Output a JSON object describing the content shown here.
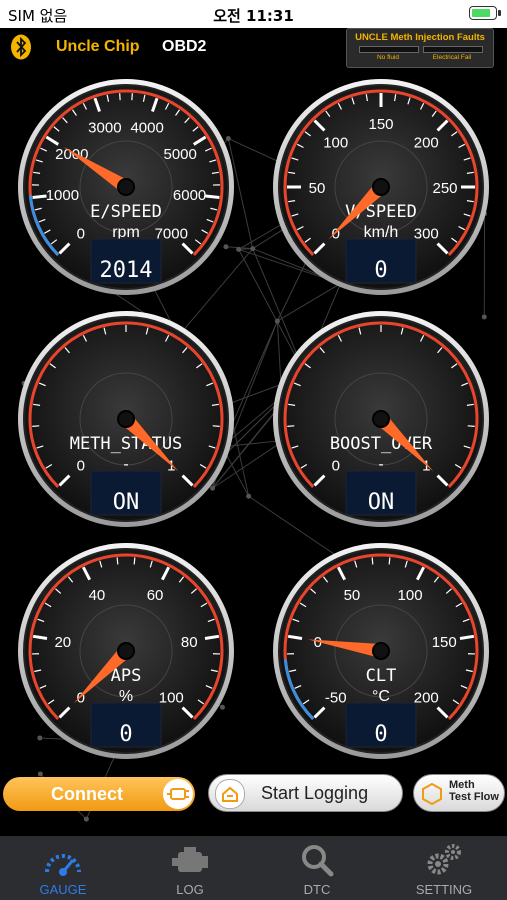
{
  "status_bar": {
    "carrier": "SIM 없음",
    "time": "오전 11:31"
  },
  "header": {
    "brand": "Uncle Chip",
    "protocol": "OBD2"
  },
  "fault_panel": {
    "title": "UNCLE Meth Injection Faults",
    "indicators": [
      "No fluid",
      "Electrical Fail"
    ]
  },
  "gauges": [
    {
      "label": "E/SPEED",
      "unit": "rpm",
      "display": "2014",
      "ticks": [
        "0",
        "1000",
        "2000",
        "3000",
        "4000",
        "5000",
        "6000",
        "7000"
      ],
      "min": 0,
      "max": 7000,
      "value": 2014
    },
    {
      "label": "V/SPEED",
      "unit": "km/h",
      "display": "0",
      "ticks": [
        "0",
        "50",
        "100",
        "150",
        "200",
        "250",
        "300"
      ],
      "min": 0,
      "max": 300,
      "value": 0
    },
    {
      "label": "METH_STATUS",
      "unit": "-",
      "display": "ON",
      "ticks": [
        "0",
        "1"
      ],
      "min": 0,
      "max": 1,
      "value": 1
    },
    {
      "label": "BOOST_OVER",
      "unit": "-",
      "display": "ON",
      "ticks": [
        "0",
        "1"
      ],
      "min": 0,
      "max": 1,
      "value": 1
    },
    {
      "label": "APS",
      "unit": "%",
      "display": "0",
      "ticks": [
        "0",
        "20",
        "40",
        "60",
        "80",
        "100"
      ],
      "min": 0,
      "max": 100,
      "value": 0
    },
    {
      "label": "CLT",
      "unit": "°C",
      "display": "0",
      "ticks": [
        "-50",
        "0",
        "50",
        "100",
        "150",
        "200"
      ],
      "min": -50,
      "max": 200,
      "value": 0
    }
  ],
  "buttons": {
    "connect": "Connect",
    "start_logging": "Start Logging",
    "meth_test_line1": "Meth",
    "meth_test_line2": "Test Flow"
  },
  "tabs": [
    {
      "label": "GAUGE",
      "icon": "gauge-icon",
      "active": true
    },
    {
      "label": "LOG",
      "icon": "engine-icon",
      "active": false
    },
    {
      "label": "DTC",
      "icon": "search-icon",
      "active": false
    },
    {
      "label": "SETTING",
      "icon": "gears-icon",
      "active": false
    }
  ],
  "colors": {
    "accent": "#f4b400",
    "needle": "#ff6a2a",
    "redline": "#e8452c",
    "cold": "#3a8fe0",
    "tab_active": "#2e7bea"
  }
}
